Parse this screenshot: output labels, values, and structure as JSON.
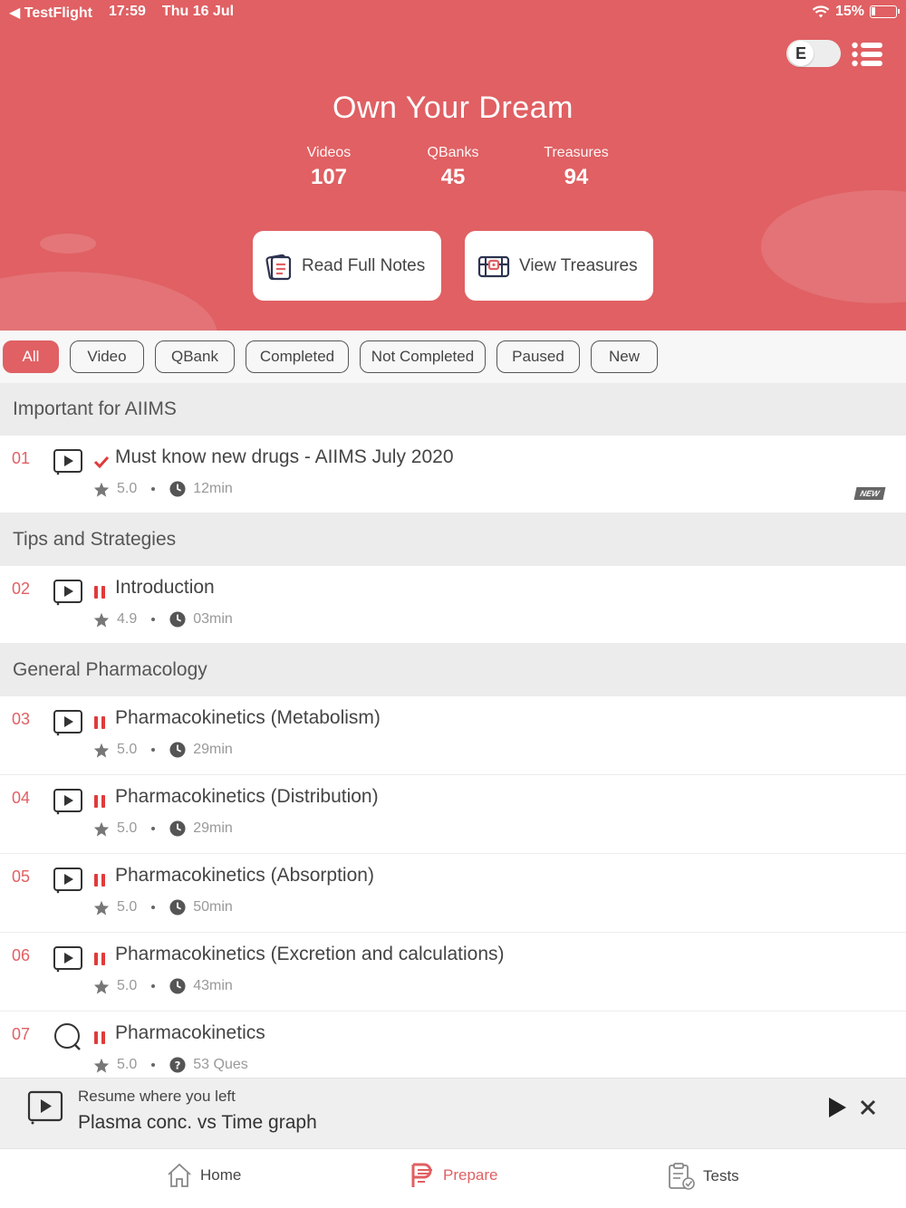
{
  "status_bar": {
    "back_app": "TestFlight",
    "time": "17:59",
    "date": "Thu 16 Jul",
    "battery": "15%"
  },
  "header": {
    "title": "Own Your Dream",
    "toggle_letter": "E",
    "stats": [
      {
        "label": "Videos",
        "value": "107"
      },
      {
        "label": "QBanks",
        "value": "45"
      },
      {
        "label": "Treasures",
        "value": "94"
      }
    ],
    "read_notes_label": "Read Full Notes",
    "view_treasures_label": "View Treasures"
  },
  "filters": [
    {
      "label": "All",
      "active": true
    },
    {
      "label": "Video",
      "active": false
    },
    {
      "label": "QBank",
      "active": false
    },
    {
      "label": "Completed",
      "active": false
    },
    {
      "label": "Not Completed",
      "active": false
    },
    {
      "label": "Paused",
      "active": false
    },
    {
      "label": "New",
      "active": false
    }
  ],
  "sections": [
    {
      "title": "Important for AIIMS",
      "items": [
        {
          "num": "01",
          "type": "video",
          "status": "completed",
          "title": "Must know new drugs - AIIMS July 2020",
          "rating": "5.0",
          "info": "12min",
          "info_icon": "clock-icon",
          "badge": "NEW"
        }
      ]
    },
    {
      "title": "Tips and Strategies",
      "items": [
        {
          "num": "02",
          "type": "video",
          "status": "paused",
          "title": "Introduction",
          "rating": "4.9",
          "info": "03min",
          "info_icon": "clock-icon"
        }
      ]
    },
    {
      "title": "General Pharmacology",
      "items": [
        {
          "num": "03",
          "type": "video",
          "status": "paused",
          "title": "Pharmacokinetics (Metabolism)",
          "rating": "5.0",
          "info": "29min",
          "info_icon": "clock-icon"
        },
        {
          "num": "04",
          "type": "video",
          "status": "paused",
          "title": "Pharmacokinetics (Distribution)",
          "rating": "5.0",
          "info": "29min",
          "info_icon": "clock-icon"
        },
        {
          "num": "05",
          "type": "video",
          "status": "paused",
          "title": "Pharmacokinetics (Absorption)",
          "rating": "5.0",
          "info": "50min",
          "info_icon": "clock-icon"
        },
        {
          "num": "06",
          "type": "video",
          "status": "paused",
          "title": "Pharmacokinetics (Excretion and calculations)",
          "rating": "5.0",
          "info": "43min",
          "info_icon": "clock-icon"
        },
        {
          "num": "07",
          "type": "qbank",
          "status": "paused",
          "title": "Pharmacokinetics",
          "rating": "5.0",
          "info": "53 Ques",
          "info_icon": "question-icon"
        }
      ]
    }
  ],
  "resume": {
    "label": "Resume where you left",
    "title": "Plasma conc. vs Time graph"
  },
  "tabs": [
    {
      "label": "Home",
      "icon": "home-icon",
      "active": false
    },
    {
      "label": "Prepare",
      "icon": "prepare-icon",
      "active": true
    },
    {
      "label": "Tests",
      "icon": "tests-icon",
      "active": false
    }
  ],
  "colors": {
    "accent": "#e06063",
    "completed": "#e03b3b",
    "paused": "#e03b3b"
  }
}
